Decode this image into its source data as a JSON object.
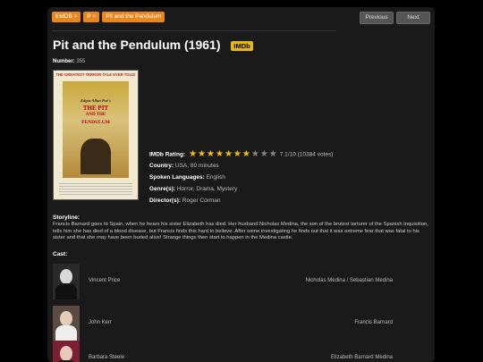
{
  "breadcrumbs": [
    "EMDB >",
    "P >",
    "Pit and the Pendulum"
  ],
  "nav": {
    "previous": "Previous",
    "next": "Next"
  },
  "movie": {
    "title": "Pit and the Pendulum (1961)",
    "imdb_badge": "IMDb",
    "number_label": "Number:",
    "number": "355",
    "poster": {
      "tagline": "THE GREATEST TERROR TALE EVER TOLD!",
      "author": "Edgar Allan Poe's",
      "title_lines": [
        "THE PIT",
        "AND THE",
        "PENDULUM"
      ]
    },
    "rating_label": "IMDb Rating:",
    "rating_stars_on": 7,
    "rating_stars_total": 10,
    "rating_text": "7.1/10 (10384 votes)",
    "country_label": "Country:",
    "country": "USA, 80 minutes",
    "languages_label": "Spoken Languages:",
    "languages": "English",
    "genres_label": "Genre(s):",
    "genres": "Horror, Drama, Mystery",
    "directors_label": "Director(s):",
    "directors": "Roger Corman",
    "storyline_label": "Storyline:",
    "storyline": "Francis Barnard goes to Spain, when he hears his sister Elizabeth has died. Her husband Nicholas Medina, the son of the brutest torturer of the Spanish Inquisition, tells him she has died of a blood disease, but Francis finds this hard to believe. After some investigating he finds out that it was extreme fear that was fatal to his sister and that she may have been buried alive! Strange things then start to happen in the Medina castle.",
    "cast_label": "Cast:",
    "cast": [
      {
        "actor": "Vincent Price",
        "role": "Nicholas Medina / Sebastian Medina"
      },
      {
        "actor": "John Kerr",
        "role": "Francis Barnard"
      },
      {
        "actor": "Barbara Steele",
        "role": "Elizabeth Barnard Medina"
      }
    ]
  },
  "colors": {
    "accent": "#e8871e",
    "badge": "#e8b90f",
    "star_on": "#f2c21b",
    "star_off": "#888888"
  },
  "icons": {
    "star": "star-icon"
  }
}
